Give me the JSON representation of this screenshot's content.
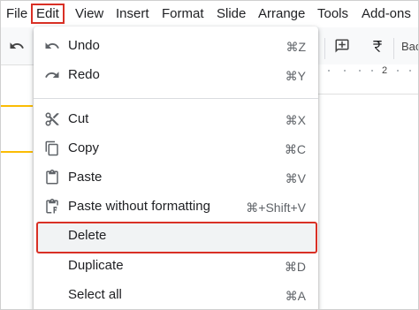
{
  "menubar": {
    "items": [
      {
        "label": "File"
      },
      {
        "label": "Edit"
      },
      {
        "label": "View"
      },
      {
        "label": "Insert"
      },
      {
        "label": "Format"
      },
      {
        "label": "Slide"
      },
      {
        "label": "Arrange"
      },
      {
        "label": "Tools"
      },
      {
        "label": "Add-ons"
      }
    ],
    "active_index": 1
  },
  "toolbar": {
    "partial_text": "Bac",
    "ruler_mark": "2"
  },
  "edit_menu": {
    "items": [
      {
        "label": "Undo",
        "shortcut": "⌘Z",
        "icon": "undo-icon"
      },
      {
        "label": "Redo",
        "shortcut": "⌘Y",
        "icon": "redo-icon"
      },
      {
        "label": "Cut",
        "shortcut": "⌘X",
        "icon": "scissors-icon"
      },
      {
        "label": "Copy",
        "shortcut": "⌘C",
        "icon": "copy-icon"
      },
      {
        "label": "Paste",
        "shortcut": "⌘V",
        "icon": "clipboard-icon"
      },
      {
        "label": "Paste without formatting",
        "shortcut": "⌘+Shift+V",
        "icon": "paste-plain-icon"
      },
      {
        "label": "Delete",
        "shortcut": "",
        "icon": ""
      },
      {
        "label": "Duplicate",
        "shortcut": "⌘D",
        "icon": ""
      },
      {
        "label": "Select all",
        "shortcut": "⌘A",
        "icon": ""
      }
    ],
    "highlighted": "Delete"
  },
  "colors": {
    "highlight_border": "#d93025",
    "slide_accent": "#fbbc04"
  }
}
